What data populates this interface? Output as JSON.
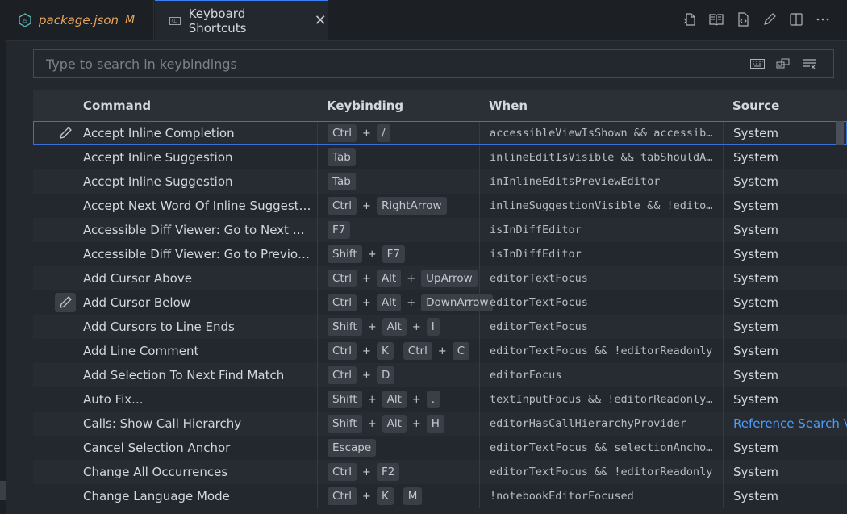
{
  "tabs": [
    {
      "label": "package.json",
      "modified": "M",
      "icon": "nodejs-icon",
      "color": "#e8a45a"
    },
    {
      "label": "Keyboard Shortcuts",
      "icon": "keyboard-icon",
      "close": "✕",
      "active": true
    }
  ],
  "toolbar": [
    "open-keybindings-json-icon",
    "split-book-icon",
    "open-to-side-icon",
    "edit-icon",
    "split-editor-icon",
    "more-actions-icon"
  ],
  "search": {
    "placeholder": "Type to search in keybindings",
    "icons": [
      "record-keys-icon",
      "sort-by-precedence-icon",
      "clear-input-icon"
    ]
  },
  "table": {
    "headers": {
      "command": "Command",
      "keybinding": "Keybinding",
      "when": "When",
      "source": "Source"
    },
    "rows": [
      {
        "command": "Accept Inline Completion",
        "keys": [
          [
            "Ctrl",
            "/"
          ]
        ],
        "when": "accessibleViewIsShown && accessibleViewCurrentProviderId == 'inlineCompletions'",
        "source": "System",
        "edit": "icon",
        "selected": true
      },
      {
        "command": "Accept Inline Suggestion",
        "keys": [
          [
            "Tab"
          ]
        ],
        "when": "inlineEditIsVisible && tabShouldAcceptInlineEdit",
        "source": "System"
      },
      {
        "command": "Accept Inline Suggestion",
        "keys": [
          [
            "Tab"
          ]
        ],
        "when": "inInlineEditsPreviewEditor",
        "source": "System"
      },
      {
        "command": "Accept Next Word Of Inline Suggestion",
        "keys": [
          [
            "Ctrl",
            "RightArrow"
          ]
        ],
        "when": "inlineSuggestionVisible && !editorReadonly",
        "source": "System"
      },
      {
        "command": "Accessible Diff Viewer: Go to Next Difference",
        "keys": [
          [
            "F7"
          ]
        ],
        "when": "isInDiffEditor",
        "source": "System"
      },
      {
        "command": "Accessible Diff Viewer: Go to Previous Difference",
        "keys": [
          [
            "Shift",
            "F7"
          ]
        ],
        "when": "isInDiffEditor",
        "source": "System"
      },
      {
        "command": "Add Cursor Above",
        "keys": [
          [
            "Ctrl",
            "Alt",
            "UpArrow"
          ]
        ],
        "when": "editorTextFocus",
        "source": "System"
      },
      {
        "command": "Add Cursor Below",
        "keys": [
          [
            "Ctrl",
            "Alt",
            "DownArrow"
          ]
        ],
        "when": "editorTextFocus",
        "source": "System",
        "edit": "hover"
      },
      {
        "command": "Add Cursors to Line Ends",
        "keys": [
          [
            "Shift",
            "Alt",
            "I"
          ]
        ],
        "when": "editorTextFocus",
        "source": "System"
      },
      {
        "command": "Add Line Comment",
        "keys": [
          [
            "Ctrl",
            "K"
          ],
          [
            "Ctrl",
            "C"
          ]
        ],
        "when": "editorTextFocus && !editorReadonly",
        "source": "System"
      },
      {
        "command": "Add Selection To Next Find Match",
        "keys": [
          [
            "Ctrl",
            "D"
          ]
        ],
        "when": "editorFocus",
        "source": "System"
      },
      {
        "command": "Auto Fix...",
        "keys": [
          [
            "Shift",
            "Alt",
            "."
          ]
        ],
        "when": "textInputFocus && !editorReadonly && supportedCodeAction =~ /(\\s|^)quickfix\\b/",
        "source": "System"
      },
      {
        "command": "Calls: Show Call Hierarchy",
        "keys": [
          [
            "Shift",
            "Alt",
            "H"
          ]
        ],
        "when": "editorHasCallHierarchyProvider",
        "source": "Reference Search View",
        "source_link": true
      },
      {
        "command": "Cancel Selection Anchor",
        "keys": [
          [
            "Escape"
          ]
        ],
        "when": "editorTextFocus && selectionAnchorSet",
        "source": "System"
      },
      {
        "command": "Change All Occurrences",
        "keys": [
          [
            "Ctrl",
            "F2"
          ]
        ],
        "when": "editorTextFocus && !editorReadonly",
        "source": "System"
      },
      {
        "command": "Change Language Mode",
        "keys": [
          [
            "Ctrl",
            "K"
          ],
          [
            "M"
          ]
        ],
        "when": "!notebookEditorFocused",
        "source": "System"
      }
    ]
  },
  "colors": {
    "accent": "#3b82f6",
    "link": "#4a9eff",
    "modified": "#e8a45a"
  }
}
